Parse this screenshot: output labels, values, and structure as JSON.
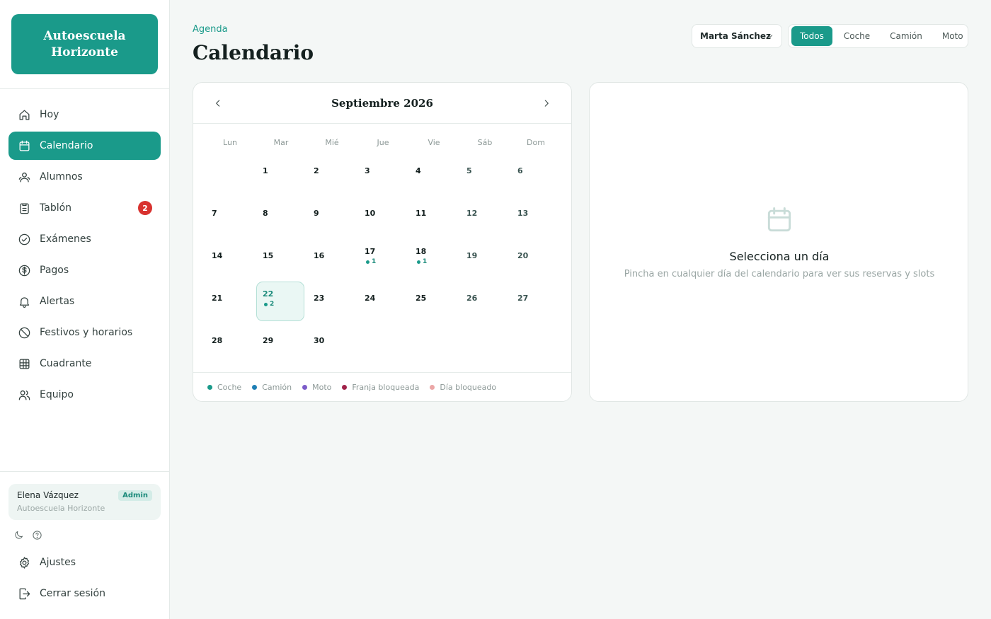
{
  "brand": {
    "name": "Autoescuela Horizonte"
  },
  "sidebar": {
    "items": [
      {
        "label": "Hoy",
        "icon": "home-icon"
      },
      {
        "label": "Calendario",
        "icon": "calendar-icon",
        "active": true
      },
      {
        "label": "Alumnos",
        "icon": "users-icon"
      },
      {
        "label": "Tablón",
        "icon": "clipboard-icon",
        "badge": "2"
      },
      {
        "label": "Exámenes",
        "icon": "check-circle-icon"
      },
      {
        "label": "Pagos",
        "icon": "dollar-icon"
      },
      {
        "label": "Alertas",
        "icon": "bell-icon"
      },
      {
        "label": "Festivos y horarios",
        "icon": "ban-icon"
      },
      {
        "label": "Cuadrante",
        "icon": "grid-icon"
      },
      {
        "label": "Equipo",
        "icon": "team-icon"
      }
    ],
    "user": {
      "name": "Elena Vázquez",
      "org": "Autoescuela Horizonte",
      "role": "Admin"
    },
    "bottom": [
      {
        "label": "Ajustes",
        "icon": "gear-icon"
      },
      {
        "label": "Cerrar sesión",
        "icon": "logout-icon"
      }
    ]
  },
  "header": {
    "breadcrumb": "Agenda",
    "title": "Calendario",
    "instructor": "Marta Sánchez",
    "filters": [
      "Todos",
      "Coche",
      "Camión",
      "Moto"
    ],
    "active_filter": "Todos"
  },
  "calendar": {
    "month_label": "Septiembre 2026",
    "weekdays": [
      "Lun",
      "Mar",
      "Mié",
      "Jue",
      "Vie",
      "Sáb",
      "Dom"
    ],
    "weeks": [
      [
        null,
        {
          "d": "1"
        },
        {
          "d": "2"
        },
        {
          "d": "3"
        },
        {
          "d": "4"
        },
        {
          "d": "5"
        },
        {
          "d": "6"
        }
      ],
      [
        {
          "d": "7"
        },
        {
          "d": "8"
        },
        {
          "d": "9"
        },
        {
          "d": "10"
        },
        {
          "d": "11"
        },
        {
          "d": "12"
        },
        {
          "d": "13"
        }
      ],
      [
        {
          "d": "14"
        },
        {
          "d": "15"
        },
        {
          "d": "16"
        },
        {
          "d": "17",
          "count": "1"
        },
        {
          "d": "18",
          "count": "1"
        },
        {
          "d": "19"
        },
        {
          "d": "20"
        }
      ],
      [
        {
          "d": "21"
        },
        {
          "d": "22",
          "count": "2",
          "selected": true
        },
        {
          "d": "23"
        },
        {
          "d": "24"
        },
        {
          "d": "25"
        },
        {
          "d": "26"
        },
        {
          "d": "27"
        }
      ],
      [
        {
          "d": "28"
        },
        {
          "d": "29"
        },
        {
          "d": "30"
        },
        null,
        null,
        null,
        null
      ]
    ],
    "legend": [
      {
        "label": "Coche",
        "color": "#1a9a8a"
      },
      {
        "label": "Camión",
        "color": "#1f7fb5"
      },
      {
        "label": "Moto",
        "color": "#7c5cc9"
      },
      {
        "label": "Franja bloqueada",
        "color": "#a1234a"
      },
      {
        "label": "Día bloqueado",
        "color": "#eba6a6"
      }
    ]
  },
  "detail": {
    "title": "Selecciona un día",
    "subtitle": "Pincha en cualquier día del calendario para ver sus reservas y slots"
  }
}
